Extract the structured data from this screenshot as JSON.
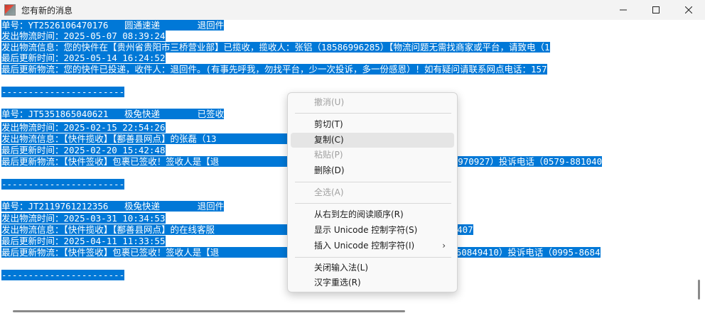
{
  "window": {
    "title": "您有新的消息",
    "minimize_icon": "minimize-icon",
    "maximize_icon": "maximize-icon",
    "close_icon": "close-icon"
  },
  "lines": [
    "单号：YT2526106470176   圆通速递       退回件",
    "发出物流时间：2025-05-07 08:39:24",
    "发出物流信息：您的快件在【贵州省贵阳市三桥营业部】已揽收，揽收人：张铝（18586996285）【物流问题无需找商家或平台，请致电（1",
    "最后更新时间：2025-05-14 16:24:52",
    "最后更新物流：您的快件已投递，收件人：退回件。(有事先呼我，勿找平台，少一次投诉，多一份感恩）！如有疑问请联系网点电话：157",
    "",
    "-----------------------",
    "",
    "单号：JT5351865040621   极兔快递       已签收",
    "发出物流时间：2025-02-15 22:54:26",
    "发出物流信息：【快件揽收】【鄯善县网点】的张磊（13                                 0995-8684407",
    "最后更新时间：2025-02-20 15:42:48",
    "最后更新物流：【快件签收】包裹已签收！签收人是【退                                 卿平佩（13065970927）投诉电话（0579-881040",
    "",
    "-----------------------",
    "",
    "单号：JT2119761212356   极兔快递       退回件",
    "发出物流时间：2025-03-31 10:34:53",
    "发出物流信息：【快件揽收】【鄯善县网点】的在线客服                                 话：0995-8684407",
    "最后更新时间：2025-04-11 11:33:55",
    "最后更新物流：【快件签收】包裹已签收！签收人是【退                                 员张小宝（15160849410）投诉电话（0995-8684",
    "",
    "-----------------------"
  ],
  "context_menu": {
    "undo": "撤消(U)",
    "cut": "剪切(T)",
    "copy": "复制(C)",
    "paste": "粘贴(P)",
    "delete": "删除(D)",
    "select_all": "全选(A)",
    "rtl": "从右到左的阅读顺序(R)",
    "show_unicode": "显示 Unicode 控制字符(S)",
    "insert_unicode": "插入 Unicode 控制字符(I)",
    "submenu_icon": "chevron-right-icon",
    "close_ime": "关闭输入法(L)",
    "reconversion": "汉字重选(R)"
  }
}
